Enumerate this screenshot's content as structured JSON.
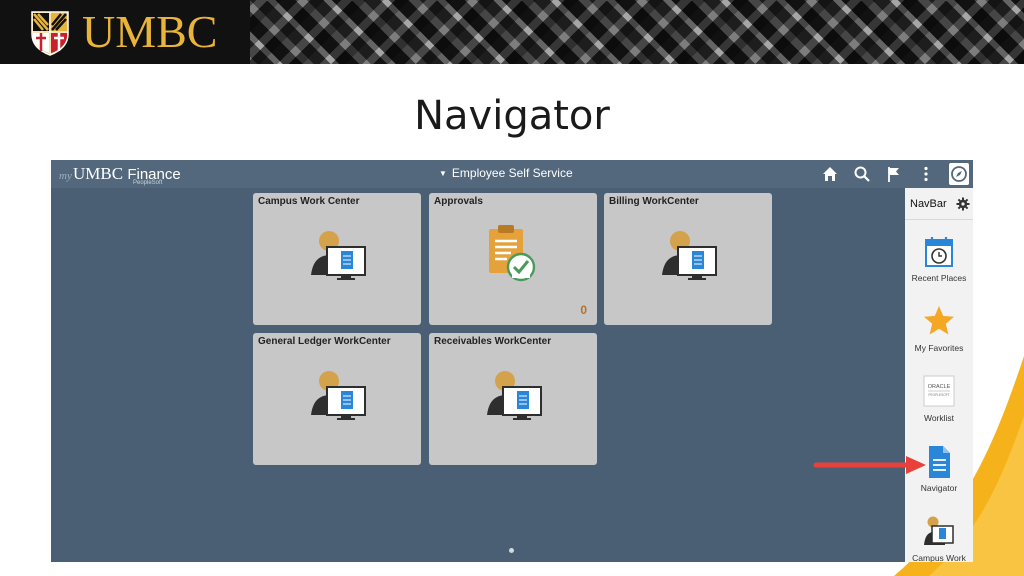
{
  "slide": {
    "logo_text": "UMBC",
    "title": "Navigator"
  },
  "app": {
    "prefix": "my",
    "name": "UMBC",
    "name_suffix": "Finance",
    "sub": "PeopleSoft",
    "homepage": "Employee Self Service",
    "toolbar_icons": [
      "home-icon",
      "search-icon",
      "flag-icon",
      "more-icon",
      "compass-icon"
    ]
  },
  "tiles": [
    {
      "title": "Campus Work Center",
      "icon": "workcenter-icon"
    },
    {
      "title": "Approvals",
      "icon": "approvals-icon",
      "count": "0"
    },
    {
      "title": "Billing WorkCenter",
      "icon": "workcenter-icon"
    },
    {
      "title": "General Ledger WorkCenter",
      "icon": "workcenter-icon"
    },
    {
      "title": "Receivables WorkCenter",
      "icon": "workcenter-icon"
    }
  ],
  "navbar": {
    "title": "NavBar",
    "items": [
      {
        "label": "Recent Places",
        "icon": "calendar-clock-icon"
      },
      {
        "label": "My Favorites",
        "icon": "star-icon"
      },
      {
        "label": "Worklist",
        "icon": "oracle-worklist-icon"
      },
      {
        "label": "Navigator",
        "icon": "document-icon"
      },
      {
        "label": "Campus Work",
        "icon": "workcenter-icon"
      }
    ]
  },
  "oracle_logo": {
    "line1": "ORACLE",
    "line2": "PEOPLESOFT"
  },
  "colors": {
    "screen_bg": "#4a5f73",
    "tile_bg": "#c7c7c7",
    "logo_gold": "#e8b43a",
    "arrow_red": "#e8403a",
    "accent_blue": "#2a86d8",
    "star_orange": "#f5a623"
  }
}
